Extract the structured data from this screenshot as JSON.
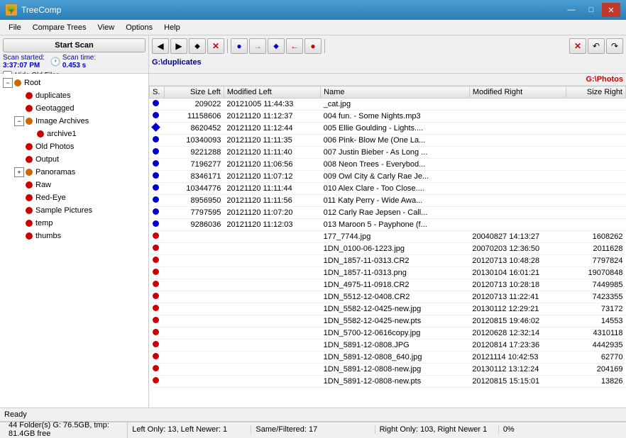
{
  "titleBar": {
    "title": "TreeComp",
    "minimizeLabel": "—",
    "maximizeLabel": "□",
    "closeLabel": "✕"
  },
  "menuBar": {
    "items": [
      "File",
      "Compare Trees",
      "View",
      "Options",
      "Help"
    ]
  },
  "leftToolbar": {
    "scanButton": "Start Scan",
    "scanStarted": "Scan started:",
    "scanTime": "Scan time:",
    "scanStartValue": "3:37:07 PM",
    "scanTimeValue": "0.453 s",
    "hideOldFiles": "Hide Old Files"
  },
  "leftPath": "G:\\duplicates",
  "rightPath": "G:\\Photos",
  "treeItems": [
    {
      "label": "Root",
      "level": 0,
      "hasExpand": true,
      "expanded": true,
      "dotColor": "orange"
    },
    {
      "label": "duplicates",
      "level": 1,
      "hasExpand": false,
      "dotColor": "red"
    },
    {
      "label": "Geotagged",
      "level": 1,
      "hasExpand": false,
      "dotColor": "red"
    },
    {
      "label": "Image Archives",
      "level": 1,
      "hasExpand": true,
      "expanded": true,
      "dotColor": "orange"
    },
    {
      "label": "archive1",
      "level": 2,
      "hasExpand": false,
      "dotColor": "red"
    },
    {
      "label": "Old Photos",
      "level": 1,
      "hasExpand": false,
      "dotColor": "red"
    },
    {
      "label": "Output",
      "level": 1,
      "hasExpand": false,
      "dotColor": "red"
    },
    {
      "label": "Panoramas",
      "level": 1,
      "hasExpand": true,
      "expanded": false,
      "dotColor": "orange"
    },
    {
      "label": "Raw",
      "level": 1,
      "hasExpand": false,
      "dotColor": "red"
    },
    {
      "label": "Red-Eye",
      "level": 1,
      "hasExpand": false,
      "dotColor": "red"
    },
    {
      "label": "Sample Pictures",
      "level": 1,
      "hasExpand": false,
      "dotColor": "red"
    },
    {
      "label": "temp",
      "level": 1,
      "hasExpand": false,
      "dotColor": "red"
    },
    {
      "label": "thumbs",
      "level": 1,
      "hasExpand": false,
      "dotColor": "red"
    }
  ],
  "tableHeaders": {
    "s": "S.",
    "sizeLeft": "Size Left",
    "modLeft": "Modified Left",
    "name": "Name",
    "modRight": "Modified Right",
    "sizeRight": "Size Right"
  },
  "tableRows": [
    {
      "dot": "blue",
      "sizeLeft": "209022",
      "modLeft": "20121005 11:44:33",
      "name": "_cat.jpg",
      "modRight": "",
      "sizeRight": ""
    },
    {
      "dot": "blue",
      "sizeLeft": "11158606",
      "modLeft": "20121120 11:12:37",
      "name": "004 fun. - Some Nights.mp3",
      "modRight": "",
      "sizeRight": ""
    },
    {
      "dot": "blue-diamond",
      "sizeLeft": "8620452",
      "modLeft": "20121120 11:12:44",
      "name": "005 Ellie Goulding - Lights....",
      "modRight": "",
      "sizeRight": ""
    },
    {
      "dot": "blue",
      "sizeLeft": "10340093",
      "modLeft": "20121120 11:11:35",
      "name": "006 Pink- Blow Me (One La...",
      "modRight": "",
      "sizeRight": ""
    },
    {
      "dot": "blue",
      "sizeLeft": "9221288",
      "modLeft": "20121120 11:11:40",
      "name": "007 Justin Bieber - As Long ...",
      "modRight": "",
      "sizeRight": ""
    },
    {
      "dot": "blue",
      "sizeLeft": "7196277",
      "modLeft": "20121120 11:06:56",
      "name": "008 Neon Trees - Everybod...",
      "modRight": "",
      "sizeRight": ""
    },
    {
      "dot": "blue",
      "sizeLeft": "8346171",
      "modLeft": "20121120 11:07:12",
      "name": "009 Owl City & Carly Rae Je...",
      "modRight": "",
      "sizeRight": ""
    },
    {
      "dot": "blue",
      "sizeLeft": "10344776",
      "modLeft": "20121120 11:11:44",
      "name": "010 Alex Clare - Too Close....",
      "modRight": "",
      "sizeRight": ""
    },
    {
      "dot": "blue",
      "sizeLeft": "8956950",
      "modLeft": "20121120 11:11:56",
      "name": "011 Katy Perry - Wide Awa...",
      "modRight": "",
      "sizeRight": ""
    },
    {
      "dot": "blue",
      "sizeLeft": "7797595",
      "modLeft": "20121120 11:07:20",
      "name": "012 Carly Rae Jepsen - Call...",
      "modRight": "",
      "sizeRight": ""
    },
    {
      "dot": "blue",
      "sizeLeft": "9286036",
      "modLeft": "20121120 11:12:03",
      "name": "013 Maroon 5 - Payphone (f...",
      "modRight": "",
      "sizeRight": ""
    },
    {
      "dot": "red",
      "sizeLeft": "",
      "modLeft": "",
      "name": "177_7744.jpg",
      "modRight": "20040827 14:13:27",
      "sizeRight": "1608262"
    },
    {
      "dot": "red",
      "sizeLeft": "",
      "modLeft": "",
      "name": "1DN_0100-06-1223.jpg",
      "modRight": "20070203 12:36:50",
      "sizeRight": "2011628"
    },
    {
      "dot": "red",
      "sizeLeft": "",
      "modLeft": "",
      "name": "1DN_1857-11-0313.CR2",
      "modRight": "20120713 10:48:28",
      "sizeRight": "7797824"
    },
    {
      "dot": "red",
      "sizeLeft": "",
      "modLeft": "",
      "name": "1DN_1857-11-0313.png",
      "modRight": "20130104 16:01:21",
      "sizeRight": "19070848"
    },
    {
      "dot": "red",
      "sizeLeft": "",
      "modLeft": "",
      "name": "1DN_4975-11-0918.CR2",
      "modRight": "20120713 10:28:18",
      "sizeRight": "7449985"
    },
    {
      "dot": "red",
      "sizeLeft": "",
      "modLeft": "",
      "name": "1DN_5512-12-0408.CR2",
      "modRight": "20120713 11:22:41",
      "sizeRight": "7423355"
    },
    {
      "dot": "red",
      "sizeLeft": "",
      "modLeft": "",
      "name": "1DN_5582-12-0425-new.jpg",
      "modRight": "20130112 12:29:21",
      "sizeRight": "73172"
    },
    {
      "dot": "red",
      "sizeLeft": "",
      "modLeft": "",
      "name": "1DN_5582-12-0425-new.pts",
      "modRight": "20120815 19:46:02",
      "sizeRight": "14553"
    },
    {
      "dot": "red",
      "sizeLeft": "",
      "modLeft": "",
      "name": "1DN_5700-12-0616copy.jpg",
      "modRight": "20120628 12:32:14",
      "sizeRight": "4310118"
    },
    {
      "dot": "red",
      "sizeLeft": "",
      "modLeft": "",
      "name": "1DN_5891-12-0808.JPG",
      "modRight": "20120814 17:23:36",
      "sizeRight": "4442935"
    },
    {
      "dot": "red",
      "sizeLeft": "",
      "modLeft": "",
      "name": "1DN_5891-12-0808_640.jpg",
      "modRight": "20121114 10:42:53",
      "sizeRight": "62770"
    },
    {
      "dot": "red",
      "sizeLeft": "",
      "modLeft": "",
      "name": "1DN_5891-12-0808-new.jpg",
      "modRight": "20130112 13:12:24",
      "sizeRight": "204169"
    },
    {
      "dot": "red",
      "sizeLeft": "",
      "modLeft": "",
      "name": "1DN_5891-12-0808-new.pts",
      "modRight": "20120815 15:15:01",
      "sizeRight": "13826"
    }
  ],
  "statusTop": "Ready",
  "statusBottom": {
    "left": "44 Folder(s) G: 76.5GB, tmp: 81.4GB free",
    "leftOnly": "Left Only: 13, Left Newer: 1",
    "sameFiltered": "Same/Filtered: 17",
    "rightOnly": "Right Only: 103, Right Newer 1",
    "progress": "0%"
  },
  "toolbarButtons": {
    "left": [
      "◀",
      "▶",
      "◆",
      "✕"
    ],
    "middle": [
      "●",
      "→",
      "◆",
      "←",
      "●"
    ],
    "right": [
      "✕",
      "↶",
      "↷"
    ]
  }
}
